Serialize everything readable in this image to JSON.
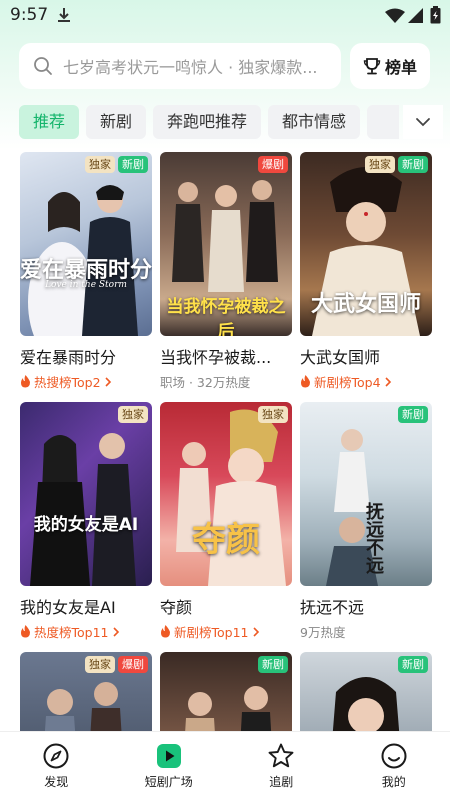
{
  "status": {
    "time": "9:57"
  },
  "search": {
    "placeholder": "七岁高考状元一鸣惊人 · 独家爆款..."
  },
  "rank_button": {
    "label": "榜单"
  },
  "tabs": [
    {
      "label": "推荐",
      "active": true
    },
    {
      "label": "新剧",
      "active": false
    },
    {
      "label": "奔跑吧推荐",
      "active": false
    },
    {
      "label": "都市情感",
      "active": false
    }
  ],
  "cards": [
    {
      "title": "爱在暴雨时分",
      "poster_title": "爱在暴雨时分",
      "poster_en": "Love in the Storm",
      "sub": "热搜榜Top2",
      "sub_hot": true,
      "badges": [
        "独家",
        "新剧"
      ]
    },
    {
      "title": "当我怀孕被裁...",
      "poster_title": "当我怀孕被裁之后",
      "sub": "职场 · 32万热度",
      "sub_hot": false,
      "badges": [
        "爆剧"
      ]
    },
    {
      "title": "大武女国师",
      "poster_title": "大武女国师",
      "sub": "新剧榜Top4",
      "sub_hot": true,
      "badges": [
        "独家",
        "新剧"
      ]
    },
    {
      "title": "我的女友是AI",
      "poster_title": "我的女友是AI",
      "sub": "热度榜Top11",
      "sub_hot": true,
      "badges": [
        "独家"
      ]
    },
    {
      "title": "夺颜",
      "poster_title": "夺颜",
      "sub": "新剧榜Top11",
      "sub_hot": true,
      "badges": [
        "独家"
      ]
    },
    {
      "title": "抚远不远",
      "poster_title": "抚远不远",
      "sub": "9万热度",
      "sub_hot": false,
      "badges": [
        "新剧"
      ]
    },
    {
      "title": "",
      "poster_title": "",
      "sub": "",
      "sub_hot": false,
      "badges": [
        "独家",
        "爆剧"
      ]
    },
    {
      "title": "",
      "poster_title": "",
      "sub": "",
      "sub_hot": false,
      "badges": [
        "新剧"
      ]
    },
    {
      "title": "",
      "poster_title": "",
      "sub": "",
      "sub_hot": false,
      "badges": [
        "新剧"
      ]
    }
  ],
  "nav": [
    {
      "label": "发现",
      "icon": "compass-icon",
      "active": false
    },
    {
      "label": "短剧广场",
      "icon": "play-square-icon",
      "active": true
    },
    {
      "label": "追剧",
      "icon": "star-icon",
      "active": false
    },
    {
      "label": "我的",
      "icon": "smiley-icon",
      "active": false
    }
  ],
  "colors": {
    "accent": "#14b46b",
    "hot": "#ee5a24",
    "new_badge": "#28c27a",
    "hot_badge": "#f0483e"
  }
}
